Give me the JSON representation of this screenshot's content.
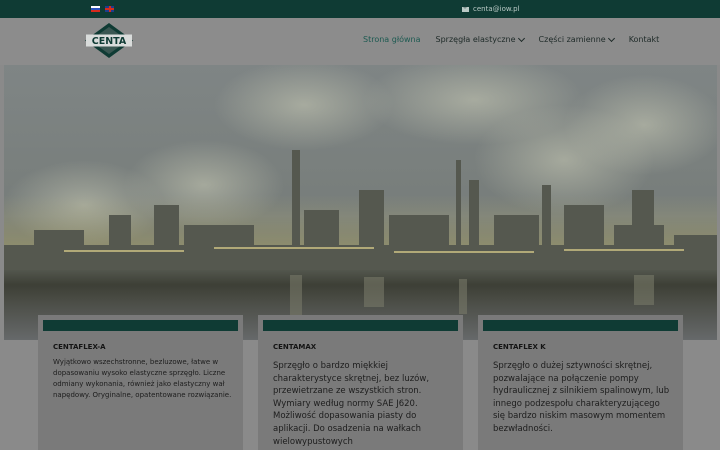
{
  "topbar": {
    "languages": [
      {
        "icon": "russian-flag-icon"
      },
      {
        "icon": "uk-flag-icon"
      }
    ],
    "email_icon": "envelope-icon",
    "email": "centa@iow.pl"
  },
  "header": {
    "logo_text": "CENTA",
    "nav": [
      {
        "label": "Strona główna",
        "active": true
      },
      {
        "label": "Sprzęgła elastyczne",
        "dropdown": true
      },
      {
        "label": "Części zamienne",
        "dropdown": true
      },
      {
        "label": "Kontakt"
      }
    ]
  },
  "cards": [
    {
      "title": "CENTAFLEX-A",
      "text": "Wyjątkowo wszechstronne, bezluzowe, łatwe w dopasowaniu wysoko elastyczne sprzęgło. Liczne odmiany wykonania, również jako elastyczny wał napędowy. Oryginalne, opatentowane rozwiązanie."
    },
    {
      "title": "CENTAMAX",
      "text": "Sprzęgło o bardzo miękkiej charakterystyce skrętnej, bez luzów, przewietrzane ze wszystkich stron. Wymiary według normy SAE J620. Możliwość dopasowania piasty do aplikacji. Do osadzenia na wałkach wielowypustowych"
    },
    {
      "title": "CENTAFLEX K",
      "text": "Sprzęgło o dużej sztywności skrętnej, pozwalające na połączenie pompy hydraulicznej z silnikiem spalinowym, lub innego podzespołu charakteryzującego się bardzo niskim masowym momentem bezwładności."
    }
  ],
  "colors": {
    "topbar": "#0f3b34",
    "accent": "#1c5a51"
  }
}
